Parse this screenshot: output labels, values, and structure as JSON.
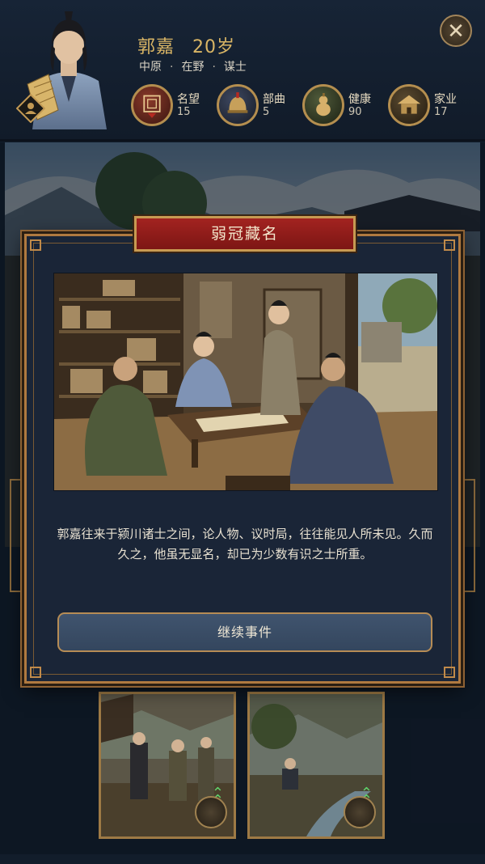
{
  "header": {
    "name": "郭嘉",
    "age": "20岁",
    "region": "中原",
    "status": "在野",
    "role": "谋士",
    "stats": [
      {
        "label": "名望",
        "value": "15",
        "icon": "seal-icon"
      },
      {
        "label": "部曲",
        "value": "5",
        "icon": "helmet-icon"
      },
      {
        "label": "健康",
        "value": "90",
        "icon": "gourd-icon"
      },
      {
        "label": "家业",
        "value": "17",
        "icon": "house-icon"
      }
    ],
    "close_icon": "✕"
  },
  "event": {
    "title": "弱冠藏名",
    "text": "郭嘉往来于颍川诸士之间，论人物、议时局，往往能见人所未见。久而久之，他虽无显名，却已为少数有识之士所重。",
    "continue_label": "继续事件"
  },
  "colors": {
    "gold": "#d9b565",
    "banner_red": "#a32320",
    "panel": "#1a2537",
    "button": "#40546e",
    "upgrade_green": "#5fd36b"
  }
}
